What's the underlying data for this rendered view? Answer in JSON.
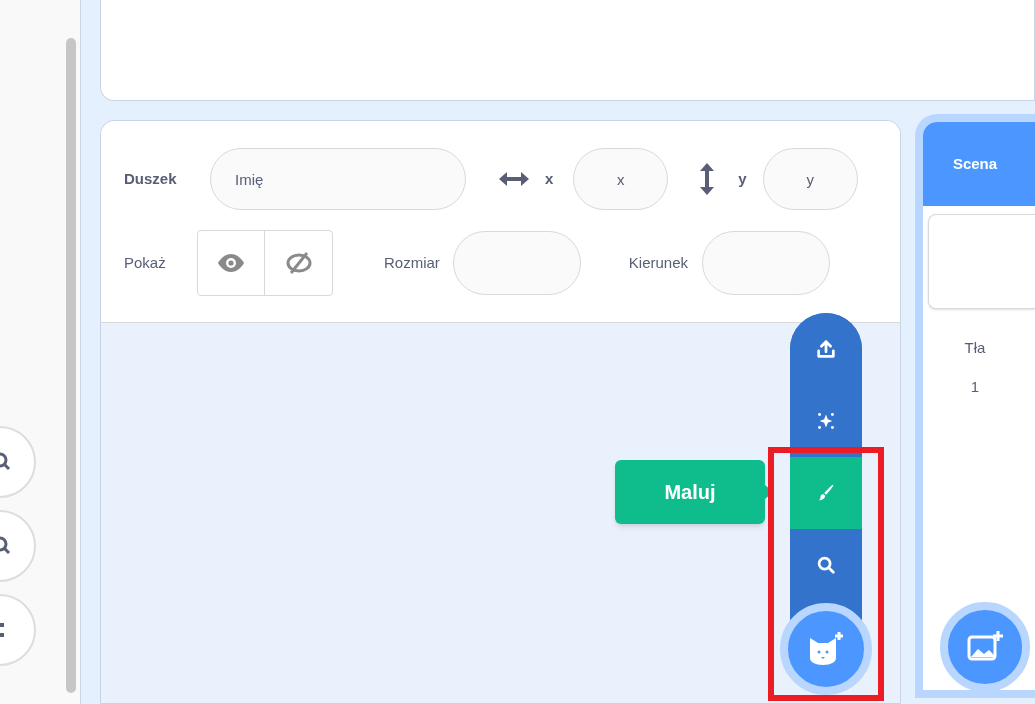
{
  "sprite_info": {
    "sprite_label": "Duszek",
    "name_placeholder": "Imię",
    "x_label": "x",
    "x_placeholder": "x",
    "y_label": "y",
    "y_placeholder": "y",
    "show_label": "Pokaż",
    "size_label": "Rozmiar",
    "direction_label": "Kierunek"
  },
  "sprite_menu": {
    "tooltip": "Maluj",
    "items": [
      {
        "kind": "upload",
        "selected": false
      },
      {
        "kind": "surprise",
        "selected": false
      },
      {
        "kind": "paint",
        "selected": true
      },
      {
        "kind": "search",
        "selected": false
      }
    ]
  },
  "stage": {
    "tab": "Scena",
    "backdrops_label": "Tła",
    "backdrop_count": "1"
  }
}
